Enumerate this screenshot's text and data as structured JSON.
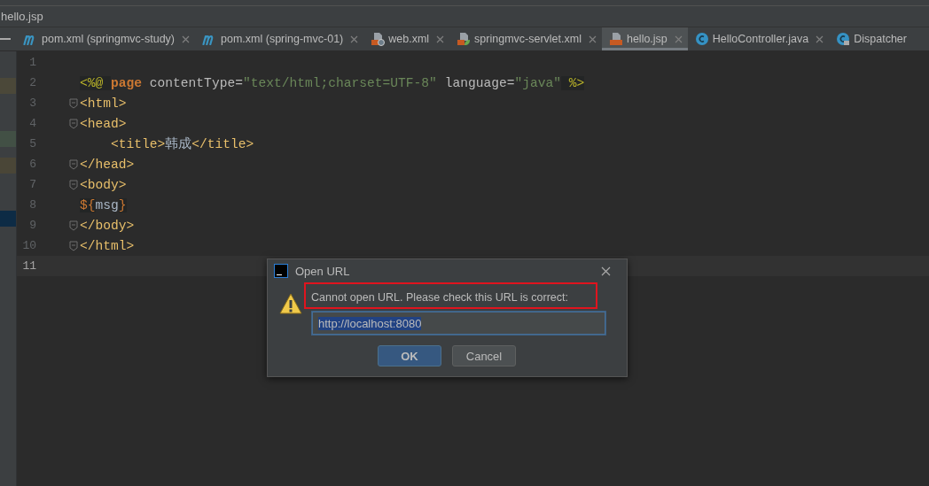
{
  "breadcrumb": "hello.jsp",
  "tabs": [
    {
      "label": "pom.xml (springmvc-study)",
      "kind": "maven",
      "selected": false,
      "closable": true
    },
    {
      "label": "pom.xml (spring-mvc-01)",
      "kind": "maven",
      "selected": false,
      "closable": true
    },
    {
      "label": "web.xml",
      "kind": "web-xml",
      "selected": false,
      "closable": true
    },
    {
      "label": "springmvc-servlet.xml",
      "kind": "spring-xml",
      "selected": false,
      "closable": true
    },
    {
      "label": "hello.jsp",
      "kind": "jsp",
      "selected": true,
      "closable": true
    },
    {
      "label": "HelloController.java",
      "kind": "class",
      "selected": false,
      "closable": true
    },
    {
      "label": "Dispatcher",
      "kind": "class-locked",
      "selected": false,
      "closable": false
    }
  ],
  "editor": {
    "lines": [
      {
        "number": "1",
        "fold": false,
        "current": false
      },
      {
        "number": "2",
        "fold": false,
        "current": false,
        "tokens": [
          {
            "kind": "directive",
            "text": "<%@ "
          },
          {
            "kind": "keyword",
            "text": "page"
          },
          {
            "kind": "attr",
            "text": " contentType="
          },
          {
            "kind": "string",
            "text": "\"text/html;charset=UTF-8\""
          },
          {
            "kind": "attr",
            "text": " language="
          },
          {
            "kind": "string",
            "text": "\"java\""
          },
          {
            "kind": "directive",
            "text": " %>"
          }
        ]
      },
      {
        "number": "3",
        "fold": true,
        "current": false,
        "tokens": [
          {
            "kind": "tag",
            "text": "<html>"
          }
        ]
      },
      {
        "number": "4",
        "fold": true,
        "current": false,
        "tokens": [
          {
            "kind": "tag",
            "text": "<head>"
          }
        ]
      },
      {
        "number": "5",
        "fold": false,
        "current": false,
        "indent": true,
        "tokens": [
          {
            "kind": "tag",
            "text": "<title>"
          },
          {
            "kind": "text",
            "text": "韩成"
          },
          {
            "kind": "tag",
            "text": "</title>"
          }
        ]
      },
      {
        "number": "6",
        "fold": true,
        "current": false,
        "tokens": [
          {
            "kind": "tag",
            "text": "</head>"
          }
        ]
      },
      {
        "number": "7",
        "fold": true,
        "current": false,
        "tokens": [
          {
            "kind": "tag",
            "text": "<body>"
          }
        ]
      },
      {
        "number": "8",
        "fold": false,
        "current": false,
        "tokens": [
          {
            "kind": "el",
            "text": "${"
          },
          {
            "kind": "text",
            "text": "msg"
          },
          {
            "kind": "el",
            "text": "}"
          }
        ]
      },
      {
        "number": "9",
        "fold": true,
        "current": false,
        "tokens": [
          {
            "kind": "tag",
            "text": "</body>"
          }
        ]
      },
      {
        "number": "10",
        "fold": true,
        "current": false,
        "tokens": [
          {
            "kind": "tag",
            "text": "</html>"
          }
        ]
      },
      {
        "number": "11",
        "fold": false,
        "current": true
      }
    ]
  },
  "dialog": {
    "title": "Open URL",
    "message": "Cannot open URL. Please check this URL is correct:",
    "url": "http://localhost:8080",
    "buttons": [
      {
        "label": "OK",
        "default": true
      },
      {
        "label": "Cancel",
        "default": false
      }
    ]
  }
}
